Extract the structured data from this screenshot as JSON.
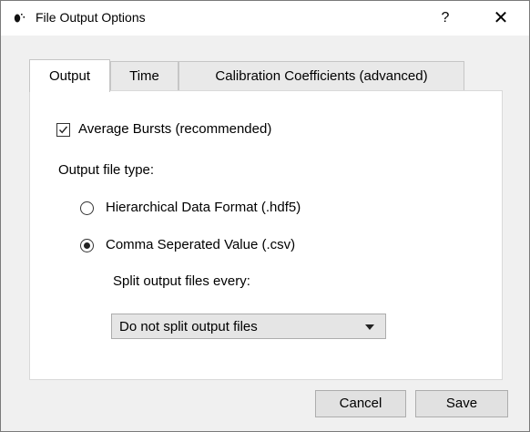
{
  "window": {
    "title": "File Output Options",
    "help": "?",
    "close": "✕",
    "icon": "app-icon"
  },
  "tabs": [
    {
      "label": "Output",
      "active": true
    },
    {
      "label": "Time",
      "active": false
    },
    {
      "label": "Calibration Coefficients (advanced)",
      "active": false
    }
  ],
  "output": {
    "average_bursts": {
      "label": "Average Bursts (recommended)",
      "checked": true
    },
    "file_type_label": "Output file type:",
    "file_types": [
      {
        "label": "Hierarchical Data Format (.hdf5)",
        "selected": false
      },
      {
        "label": "Comma Seperated Value (.csv)",
        "selected": true
      }
    ],
    "split_label": "Split output files every:",
    "split_select": {
      "value": "Do not split output files"
    }
  },
  "buttons": {
    "cancel": "Cancel",
    "save": "Save"
  }
}
